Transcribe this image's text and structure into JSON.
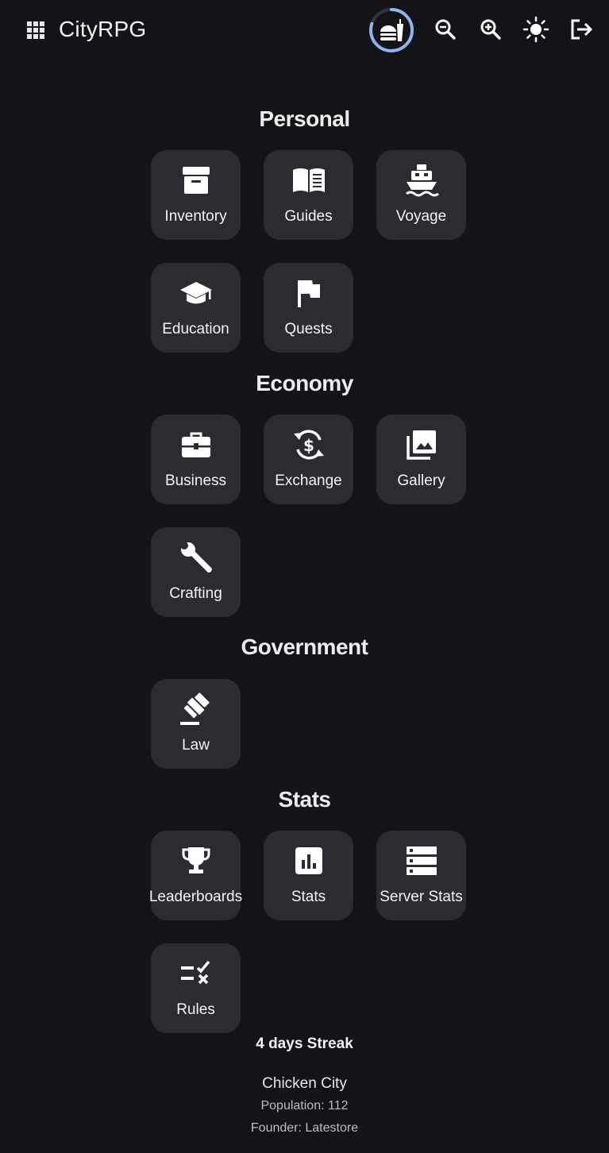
{
  "header": {
    "title": "CityRPG",
    "icons": {
      "apps": "apps-grid-icon",
      "streak": "burger-streak-icon",
      "zoom_out": "zoom-out-icon",
      "zoom_in": "zoom-in-icon",
      "theme": "sun-icon",
      "logout": "logout-icon"
    },
    "streak_progress": 0.8
  },
  "sections": [
    {
      "title": "Personal",
      "items": [
        {
          "label": "Inventory",
          "icon": "archive-box-icon"
        },
        {
          "label": "Guides",
          "icon": "open-book-icon"
        },
        {
          "label": "Voyage",
          "icon": "ship-icon"
        },
        {
          "label": "Education",
          "icon": "graduation-cap-icon"
        },
        {
          "label": "Quests",
          "icon": "flag-icon"
        }
      ]
    },
    {
      "title": "Economy",
      "items": [
        {
          "label": "Business",
          "icon": "briefcase-icon"
        },
        {
          "label": "Exchange",
          "icon": "currency-exchange-icon"
        },
        {
          "label": "Gallery",
          "icon": "photo-library-icon"
        },
        {
          "label": "Crafting",
          "icon": "wrench-icon"
        }
      ]
    },
    {
      "title": "Government",
      "items": [
        {
          "label": "Law",
          "icon": "gavel-icon"
        }
      ]
    },
    {
      "title": "Stats",
      "items": [
        {
          "label": "Leaderboards",
          "icon": "trophy-icon"
        },
        {
          "label": "Stats",
          "icon": "bar-chart-icon"
        },
        {
          "label": "Server Stats",
          "icon": "server-icon"
        },
        {
          "label": "Rules",
          "icon": "rule-checklist-icon"
        }
      ]
    }
  ],
  "footer": {
    "streak": "4 days Streak",
    "city_name": "Chicken City",
    "population": "Population: 112",
    "founder": "Founder: Latestore"
  },
  "colors": {
    "background": "#141418",
    "tile": "#2b2b31",
    "accent": "#8fb4f0"
  }
}
